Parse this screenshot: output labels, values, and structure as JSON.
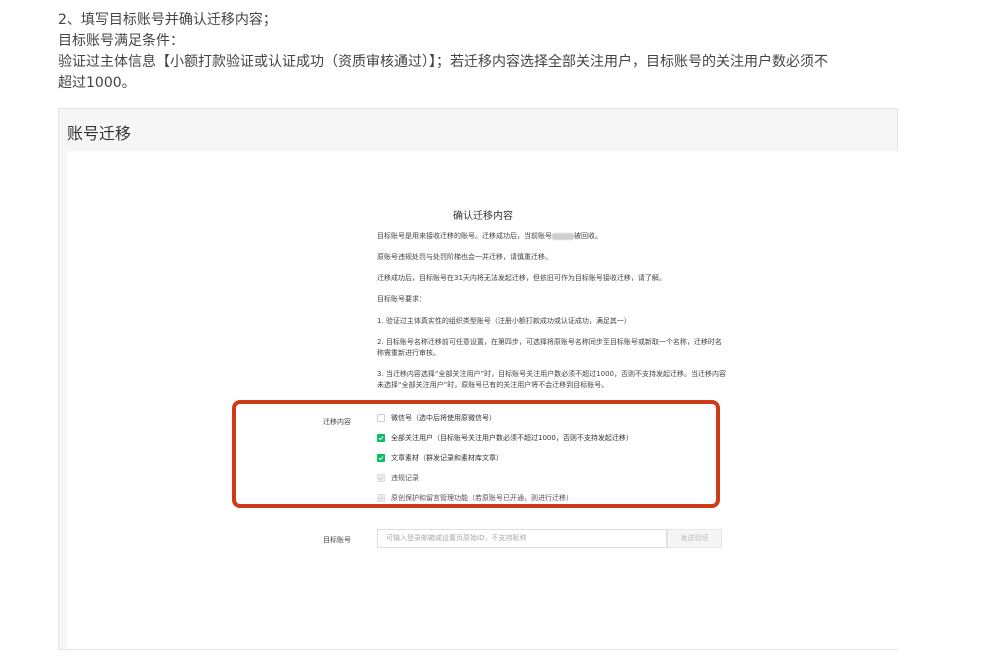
{
  "intro": {
    "line1": "2、填写目标账号并确认迁移内容；",
    "line2": "目标账号满足条件：",
    "line3": "验证过主体信息【小额打款验证或认证成功（资质审核通过）】；若迁移内容选择全部关注用户，目标账号的关注用户数必须不",
    "line4": "超过1000。"
  },
  "card": {
    "title": "账号迁移"
  },
  "dialog": {
    "title": "确认迁移内容",
    "p1_a": "目标账号是用来接收迁移的账号。迁移成功后，当前账号",
    "p1_b": "被回收。",
    "p2": "原账号违规处罚与处罚阶梯也会一并迁移，请慎重迁移。",
    "p3": "迁移成功后，目标账号在31天内将无法发起迁移，但依旧可作为目标账号接收迁移，请了解。",
    "p4": "目标账号要求：",
    "p5": "1. 验证过主体真实性的组织类型账号（注册小额打款成功或认证成功，满足其一）",
    "p6": "2. 目标账号名称迁移前可任意设置，在第四步，可选择将原账号名称同步至目标账号或新取一个名称，迁移时名称需重新进行审核。",
    "p7": "3. 当迁移内容选择“全部关注用户”时，目标账号关注用户数必须不超过1000，否则不支持发起迁移。当迁移内容未选择“全部关注用户”时，原账号已有的关注用户将不会迁移到目标账号。",
    "content_label": "迁移内容",
    "options": [
      {
        "label": "微信号（选中后将使用原微信号）",
        "state": "unchecked"
      },
      {
        "label": "全部关注用户（目标账号关注用户数必须不超过1000，否则不支持发起迁移）",
        "state": "checked"
      },
      {
        "label": "文章素材（群发记录和素材库文章）",
        "state": "checked"
      },
      {
        "label": "违规记录",
        "state": "disabled"
      },
      {
        "label": "原创保护和留言管理功能（若原账号已开通，则进行迁移）",
        "state": "disabled"
      }
    ],
    "target_label": "目标账号",
    "target_placeholder": "可输入登录邮箱或设置页原始ID，不支持昵称",
    "send_button": "发送验证"
  },
  "colors": {
    "accent": "#07c160",
    "highlight": "#cf3b17"
  }
}
